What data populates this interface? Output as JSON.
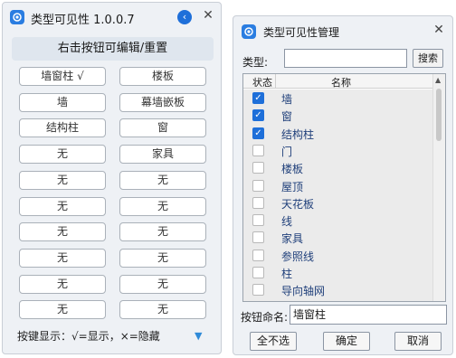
{
  "win1": {
    "title": "类型可见性 1.0.0.7",
    "collapse_glyph": "‹",
    "close_glyph": "✕",
    "header": "右击按钮可编辑/重置",
    "buttons": [
      "墙窗柱 √",
      "楼板",
      "墙",
      "幕墙嵌板",
      "结构柱",
      "窗",
      "无",
      "家具",
      "无",
      "无",
      "无",
      "无",
      "无",
      "无",
      "无",
      "无",
      "无",
      "无",
      "无",
      "无"
    ],
    "legend": "按键显示：√=显示，×=隐藏",
    "expand_glyph": "▼"
  },
  "win2": {
    "title": "类型可见性管理",
    "close_glyph": "✕",
    "type_label": "类型:",
    "type_value": "",
    "search_label": "搜索",
    "col_state": "状态",
    "col_name": "名称",
    "items": [
      {
        "name": "墙",
        "checked": true
      },
      {
        "name": "窗",
        "checked": true
      },
      {
        "name": "结构柱",
        "checked": true
      },
      {
        "name": "门",
        "checked": false
      },
      {
        "name": "楼板",
        "checked": false
      },
      {
        "name": "屋顶",
        "checked": false
      },
      {
        "name": "天花板",
        "checked": false
      },
      {
        "name": "线",
        "checked": false
      },
      {
        "name": "家具",
        "checked": false
      },
      {
        "name": "参照线",
        "checked": false
      },
      {
        "name": "柱",
        "checked": false
      },
      {
        "name": "导向轴网",
        "checked": false
      }
    ],
    "btnname_label": "按钮命名:",
    "btnname_value": "墙窗柱",
    "none_label": "全不选",
    "ok_label": "确定",
    "cancel_label": "取消"
  },
  "colors": {
    "accent": "#1e6fd9",
    "window_bg": "#eef1f5"
  },
  "icons": {
    "app": "app-swirl-icon",
    "close": "close-icon",
    "collapse": "chevron-left-icon",
    "expand": "triangle-down-icon"
  }
}
